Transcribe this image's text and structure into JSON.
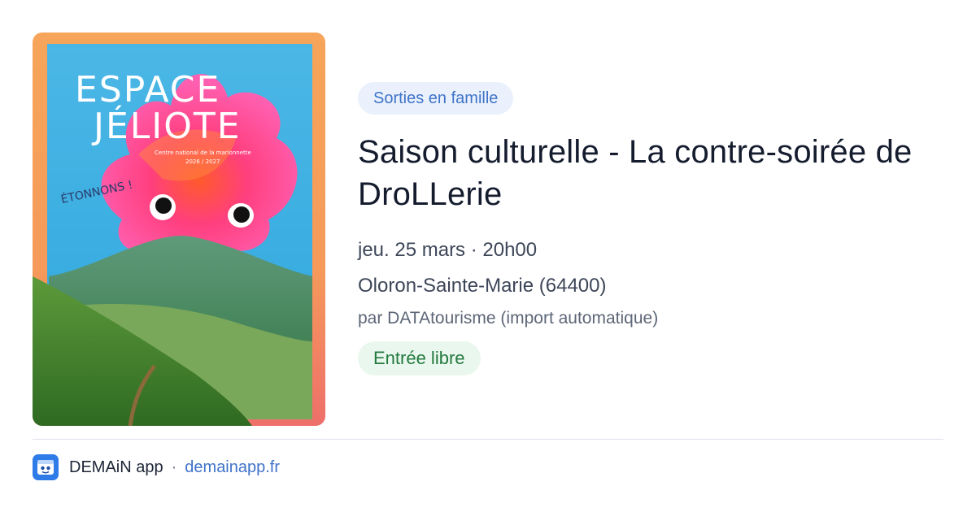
{
  "event": {
    "category": "Sorties en famille",
    "title": "Saison culturelle - La contre-soirée de DroLLerie",
    "datetime": "jeu. 25 mars · 20h00",
    "location": "Oloron-Sainte-Marie (64400)",
    "organizer": "par DATAtourisme (import automatique)",
    "price": "Entrée libre"
  },
  "poster": {
    "line1": "ESPACE",
    "line2": "JÉLIOTE",
    "subtitle": "Centre national de la marionnette",
    "season": "2026 / 2027",
    "tagline": "ÉTONNONS !"
  },
  "footer": {
    "app_name": "DEMAiN app",
    "separator": "·",
    "site": "demainapp.fr",
    "icon": "demain-app-icon"
  },
  "colors": {
    "category_bg": "#eaf1fc",
    "category_text": "#3f73c9",
    "price_bg": "#eaf7ee",
    "price_text": "#237a3e",
    "link": "#3f73c9"
  }
}
